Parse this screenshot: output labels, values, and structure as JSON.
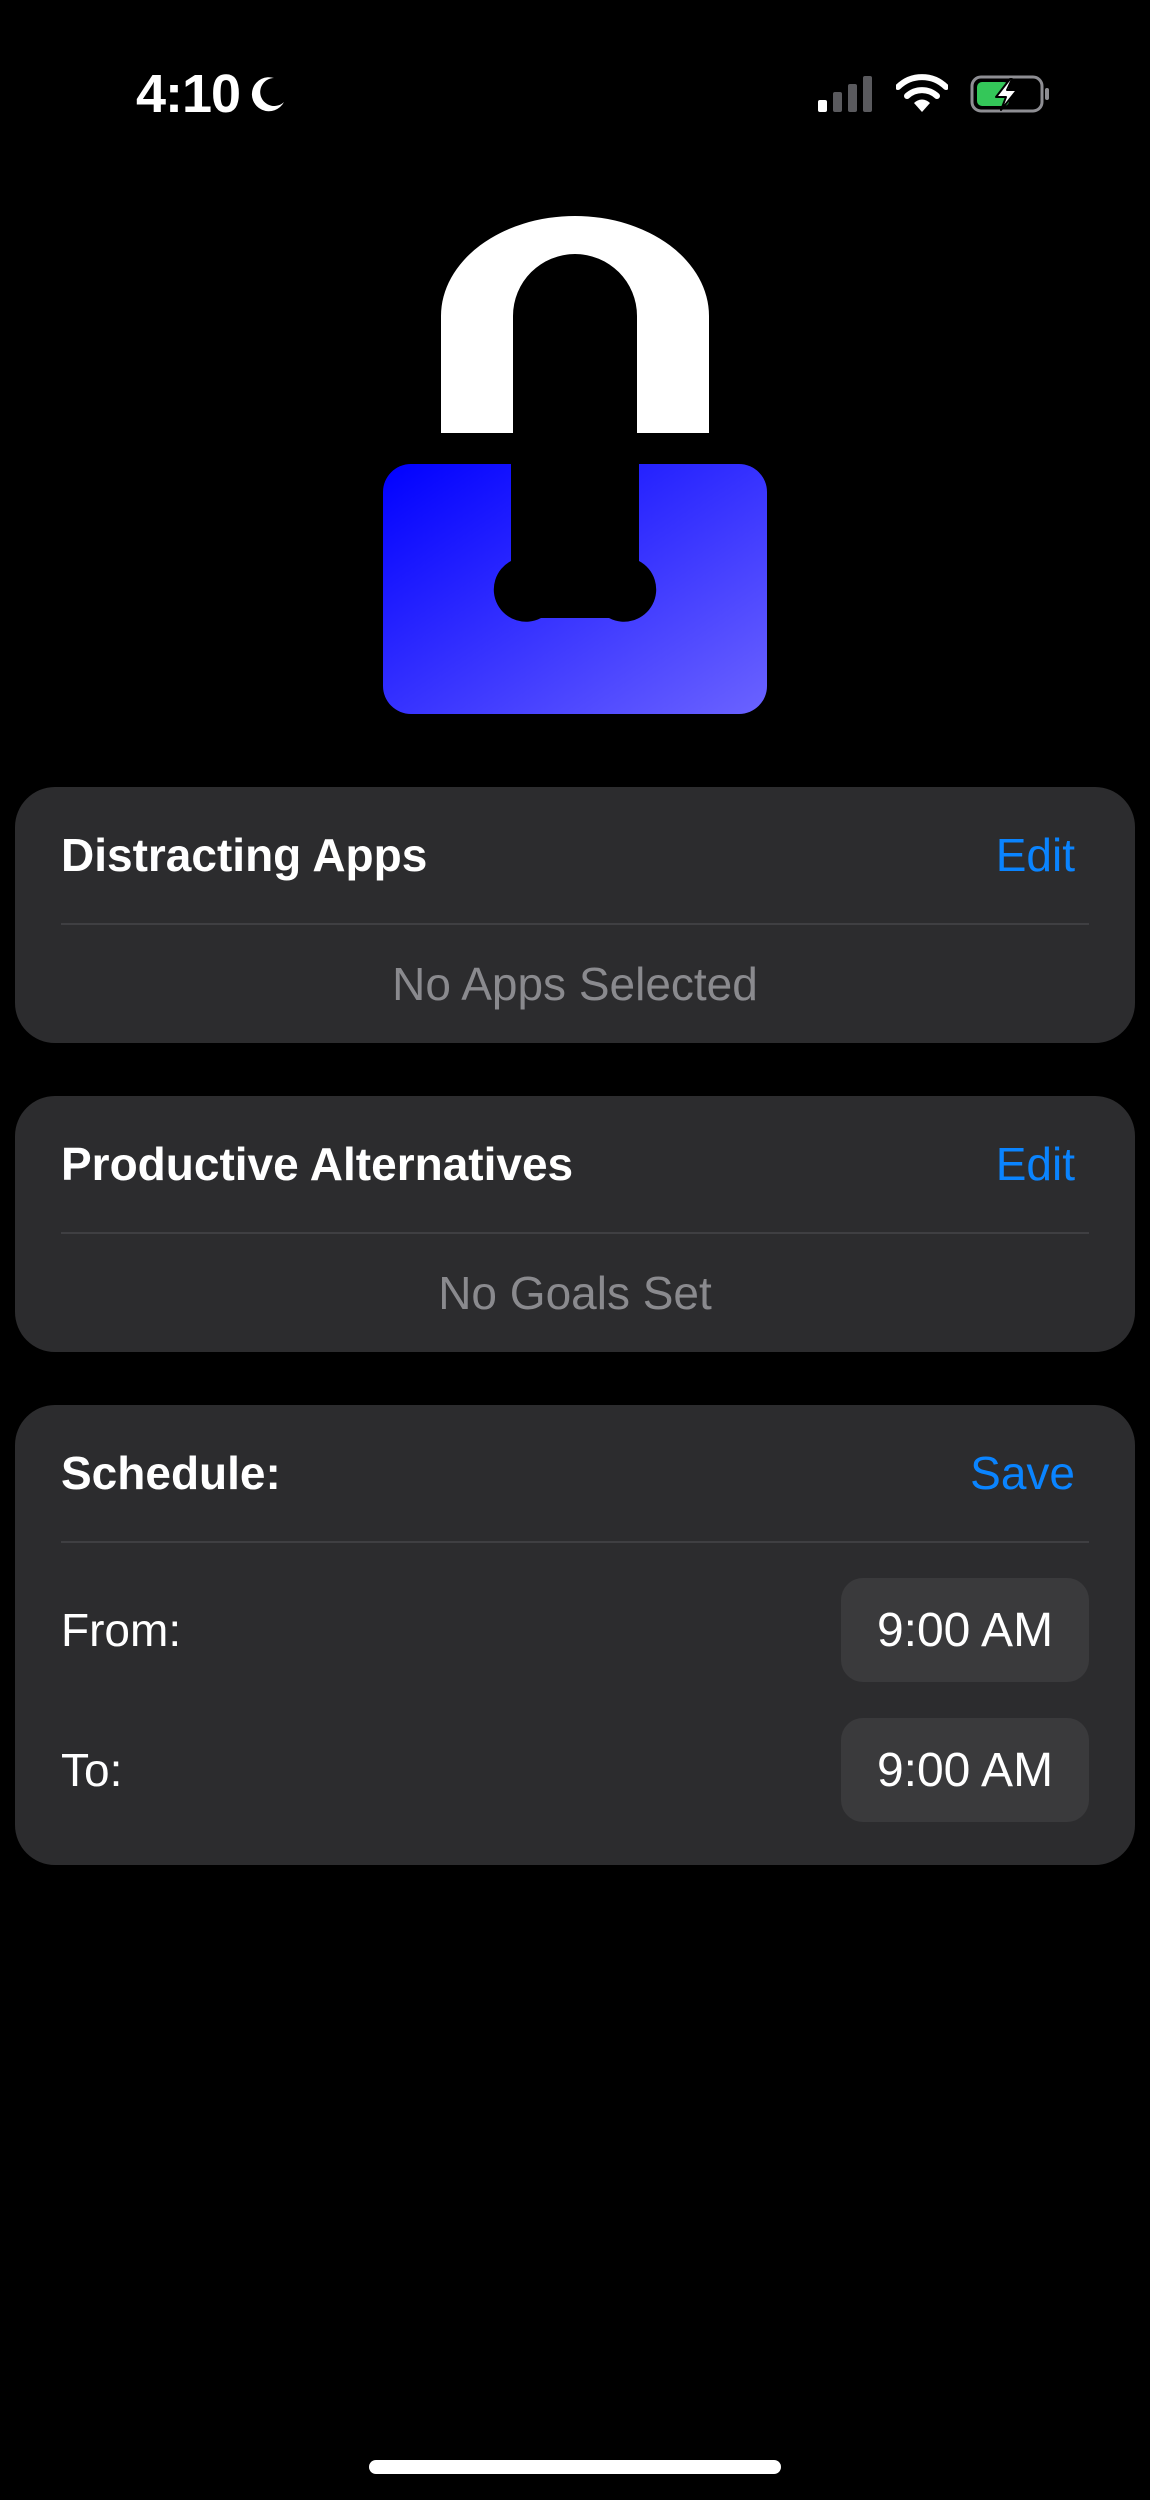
{
  "status_bar": {
    "time": "4:10",
    "icons": [
      "moon-icon",
      "signal-icon",
      "wifi-icon",
      "battery-charging-icon"
    ],
    "battery_color": "#34c759"
  },
  "hero": {
    "icon": "lock-icon",
    "gradient_colors": [
      "#0000ff",
      "#6b63ff"
    ]
  },
  "distracting_apps": {
    "title": "Distracting Apps",
    "action_label": "Edit",
    "empty_text": "No Apps Selected"
  },
  "productive_alternatives": {
    "title": "Productive Alternatives",
    "action_label": "Edit",
    "empty_text": "No Goals Set"
  },
  "schedule": {
    "title": "Schedule:",
    "action_label": "Save",
    "from_label": "From:",
    "from_time": "9:00 AM",
    "to_label": "To:",
    "to_time": "9:00 AM"
  },
  "colors": {
    "accent": "#0a84ff",
    "card_background": "#2c2c2e",
    "secondary_text": "#8a8a8e",
    "background": "#000000"
  }
}
